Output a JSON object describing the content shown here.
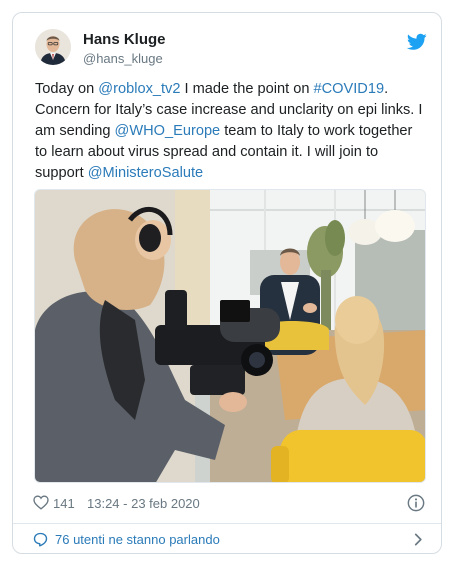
{
  "author": {
    "name": "Hans Kluge",
    "handle": "@hans_kluge"
  },
  "tweet": {
    "t1": "Today on ",
    "m1": "@roblox_tv2",
    "t2": " I made the point on ",
    "h1": "#COVID19",
    "t3": ". Concern for Italy’s case increase and unclarity on epi links. I am sending ",
    "m2": "@WHO_Europe",
    "t4": " team to Italy to work together to learn about virus spread and contain it. I will join to support ",
    "m3": "@MinisteroSalute"
  },
  "footer": {
    "likes": "141",
    "timestamp": "13:24 - 23 feb 2020",
    "conversation": "76 utenti ne stanno parlando"
  },
  "icons": {
    "bird": "twitter-bird-icon",
    "like": "heart-icon",
    "info": "info-icon",
    "conversation": "speech-bubble-icon",
    "chevron": "chevron-right-icon"
  },
  "colors": {
    "link": "#2b7bb9",
    "twitter_blue": "#1da1f2",
    "muted": "#697882",
    "text": "#1c2022",
    "border": "#d6dde2"
  }
}
